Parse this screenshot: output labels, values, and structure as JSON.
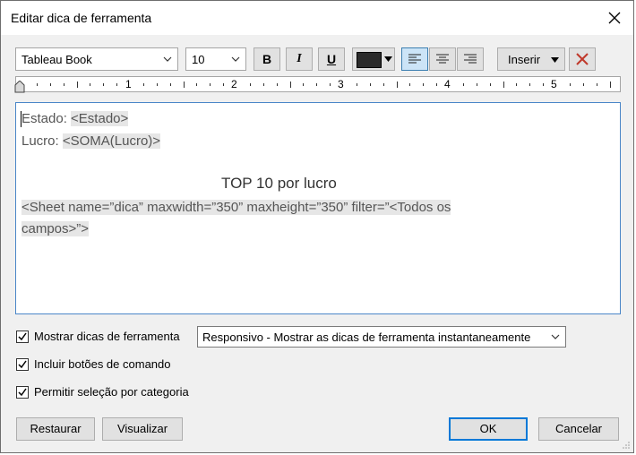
{
  "dialog": {
    "title": "Editar dica de ferramenta"
  },
  "toolbar": {
    "font": "Tableau Book",
    "size": "10",
    "bold": "B",
    "italic": "I",
    "underline": "U",
    "text_color": "#2b2b2b",
    "insert_label": "Inserir"
  },
  "ruler": {
    "marks": [
      "1",
      "2",
      "3",
      "4",
      "5"
    ]
  },
  "editor": {
    "line1_label": "Estado: ",
    "line1_field": "<Estado>",
    "line2_label": "Lucro: ",
    "line2_field": "<SOMA(Lucro)>",
    "heading": "TOP 10 por lucro",
    "sheet_line1": "<Sheet name=”dica” maxwidth=”350” maxheight=”350” filter=”<Todos os",
    "sheet_line2": "campos>”>"
  },
  "options": {
    "show_tooltips": "Mostrar dicas de ferramenta",
    "show_tooltips_checked": true,
    "tooltip_mode": "Responsivo - Mostrar as dicas de ferramenta instantaneamente",
    "include_buttons": "Incluir botões de comando",
    "include_buttons_checked": true,
    "allow_selection": "Permitir seleção por categoria",
    "allow_selection_checked": true
  },
  "buttons": {
    "reset": "Restaurar",
    "preview": "Visualizar",
    "ok": "OK",
    "cancel": "Cancelar"
  }
}
